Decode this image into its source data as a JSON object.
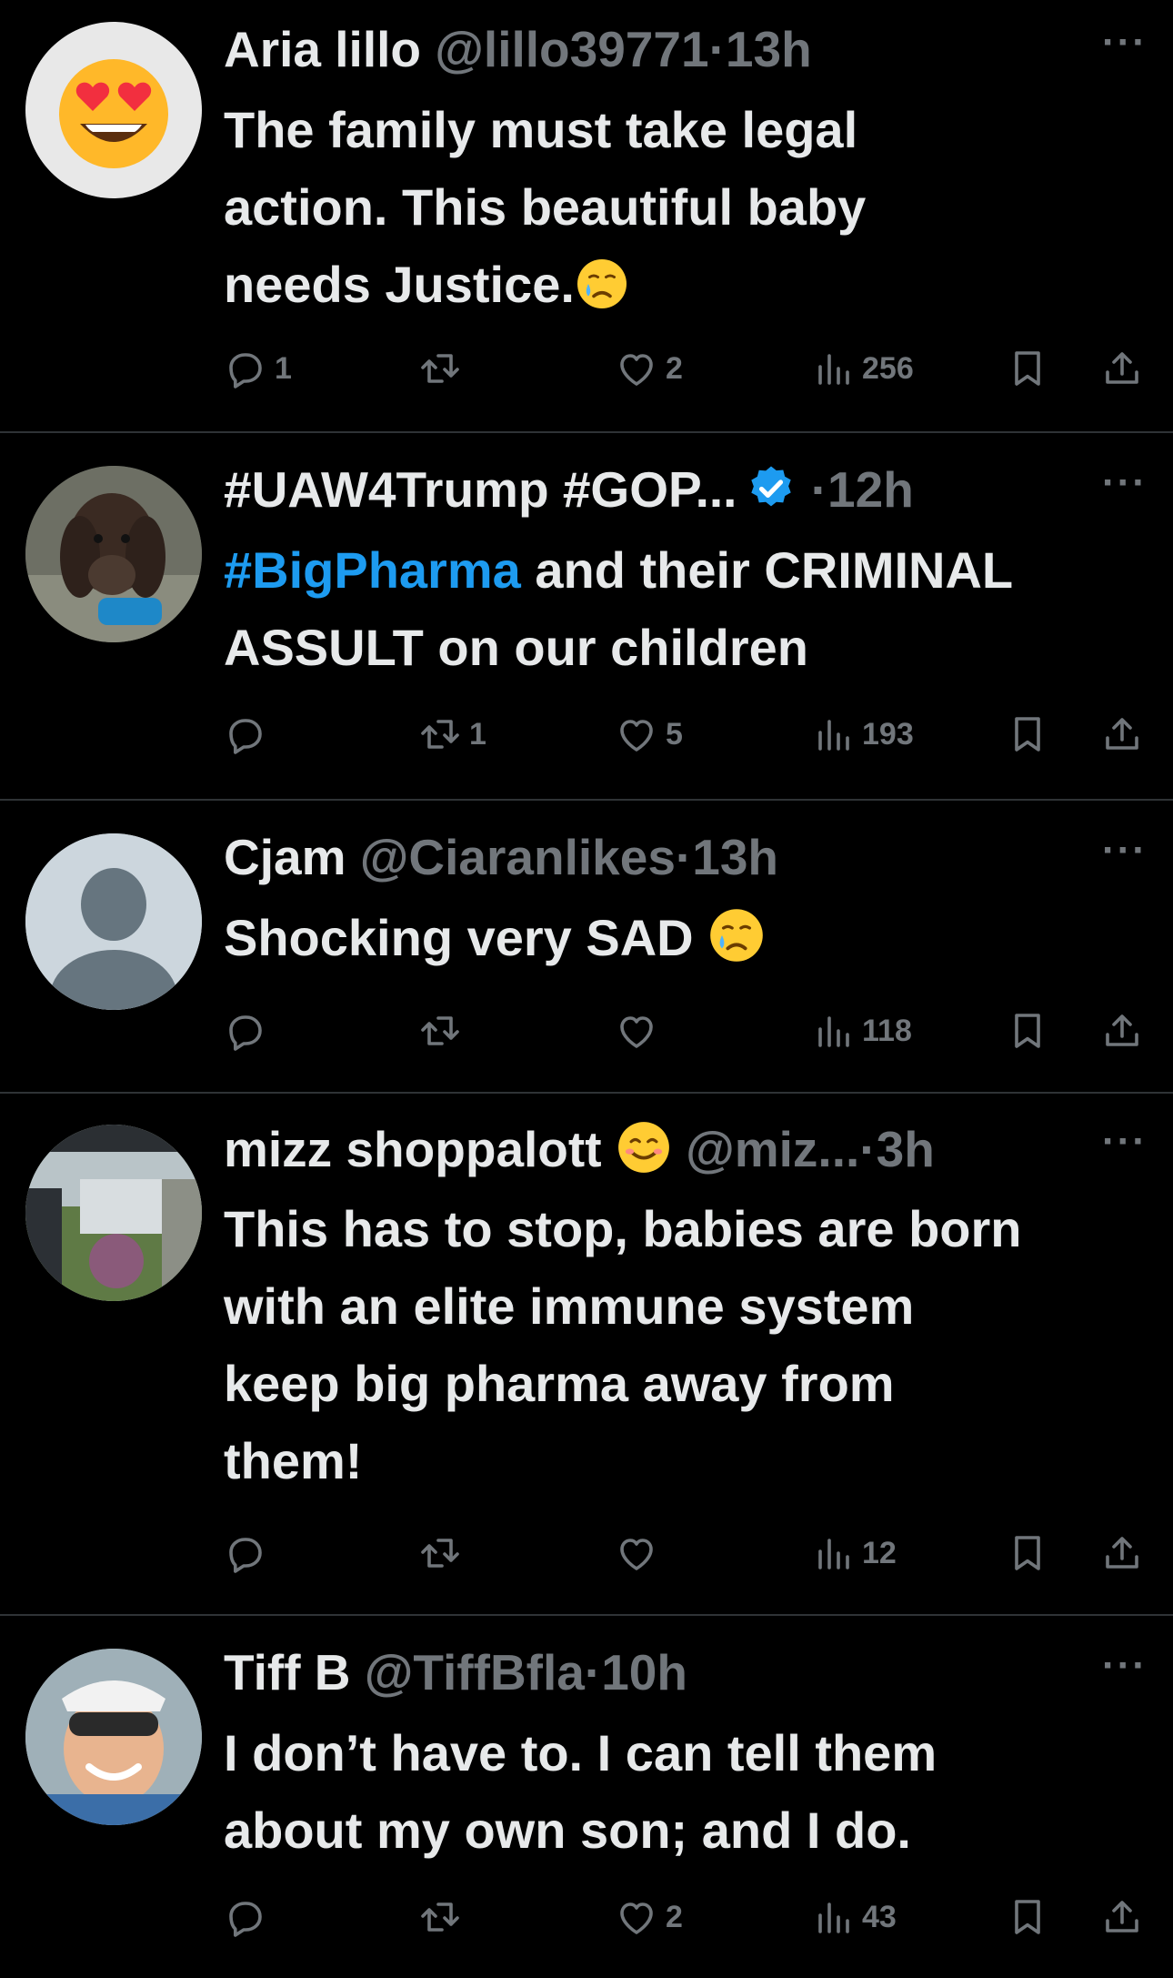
{
  "tweets": [
    {
      "name": "Aria lillo",
      "handle": "@lillo39771",
      "dot": "·",
      "time": "13h",
      "text_lines": [
        "The family must take legal",
        "action. This beautiful baby",
        "needs Justice."
      ],
      "reply_count": "1",
      "retweet_count": "",
      "like_count": "2",
      "view_count": "256",
      "more": "···"
    },
    {
      "name": "#UAW4Trump #GOP...",
      "handle": "",
      "dot": "·",
      "time": "12h",
      "hashtag": "#BigPharma",
      "text_after_hashtag": " and their CRIMINAL",
      "text_line2": "ASSULT on our children",
      "reply_count": "",
      "retweet_count": "1",
      "like_count": "5",
      "view_count": "193",
      "more": "···"
    },
    {
      "name": "Cjam",
      "handle": "@Ciaranlikes",
      "dot": "·",
      "time": "13h",
      "text_lines": [
        "Shocking very SAD"
      ],
      "reply_count": "",
      "retweet_count": "",
      "like_count": "",
      "view_count": "118",
      "more": "···"
    },
    {
      "name": "mizz shoppalott",
      "handle": "@miz...",
      "dot": "·",
      "time": "3h",
      "text_lines": [
        "This has to stop, babies are born",
        "with an elite immune system",
        "keep big pharma away from",
        "them!"
      ],
      "reply_count": "",
      "retweet_count": "",
      "like_count": "",
      "view_count": "12",
      "more": "···"
    },
    {
      "name": "Tiff B",
      "handle": "@TiffBfla",
      "dot": "·",
      "time": "10h",
      "text_lines": [
        "I don’t have to.  I can tell them",
        "about my own son; and I do."
      ],
      "reply_count": "",
      "retweet_count": "",
      "like_count": "2",
      "view_count": "43",
      "more": "···"
    }
  ],
  "icons": [
    "reply-icon",
    "retweet-icon",
    "like-icon",
    "views-icon",
    "bookmark-icon",
    "share-icon",
    "verified-badge-icon"
  ],
  "colors": {
    "background": "#000000",
    "text": "#e7e9ea",
    "muted": "#71767b",
    "link": "#1d9bf0",
    "divider": "#2f3336"
  }
}
